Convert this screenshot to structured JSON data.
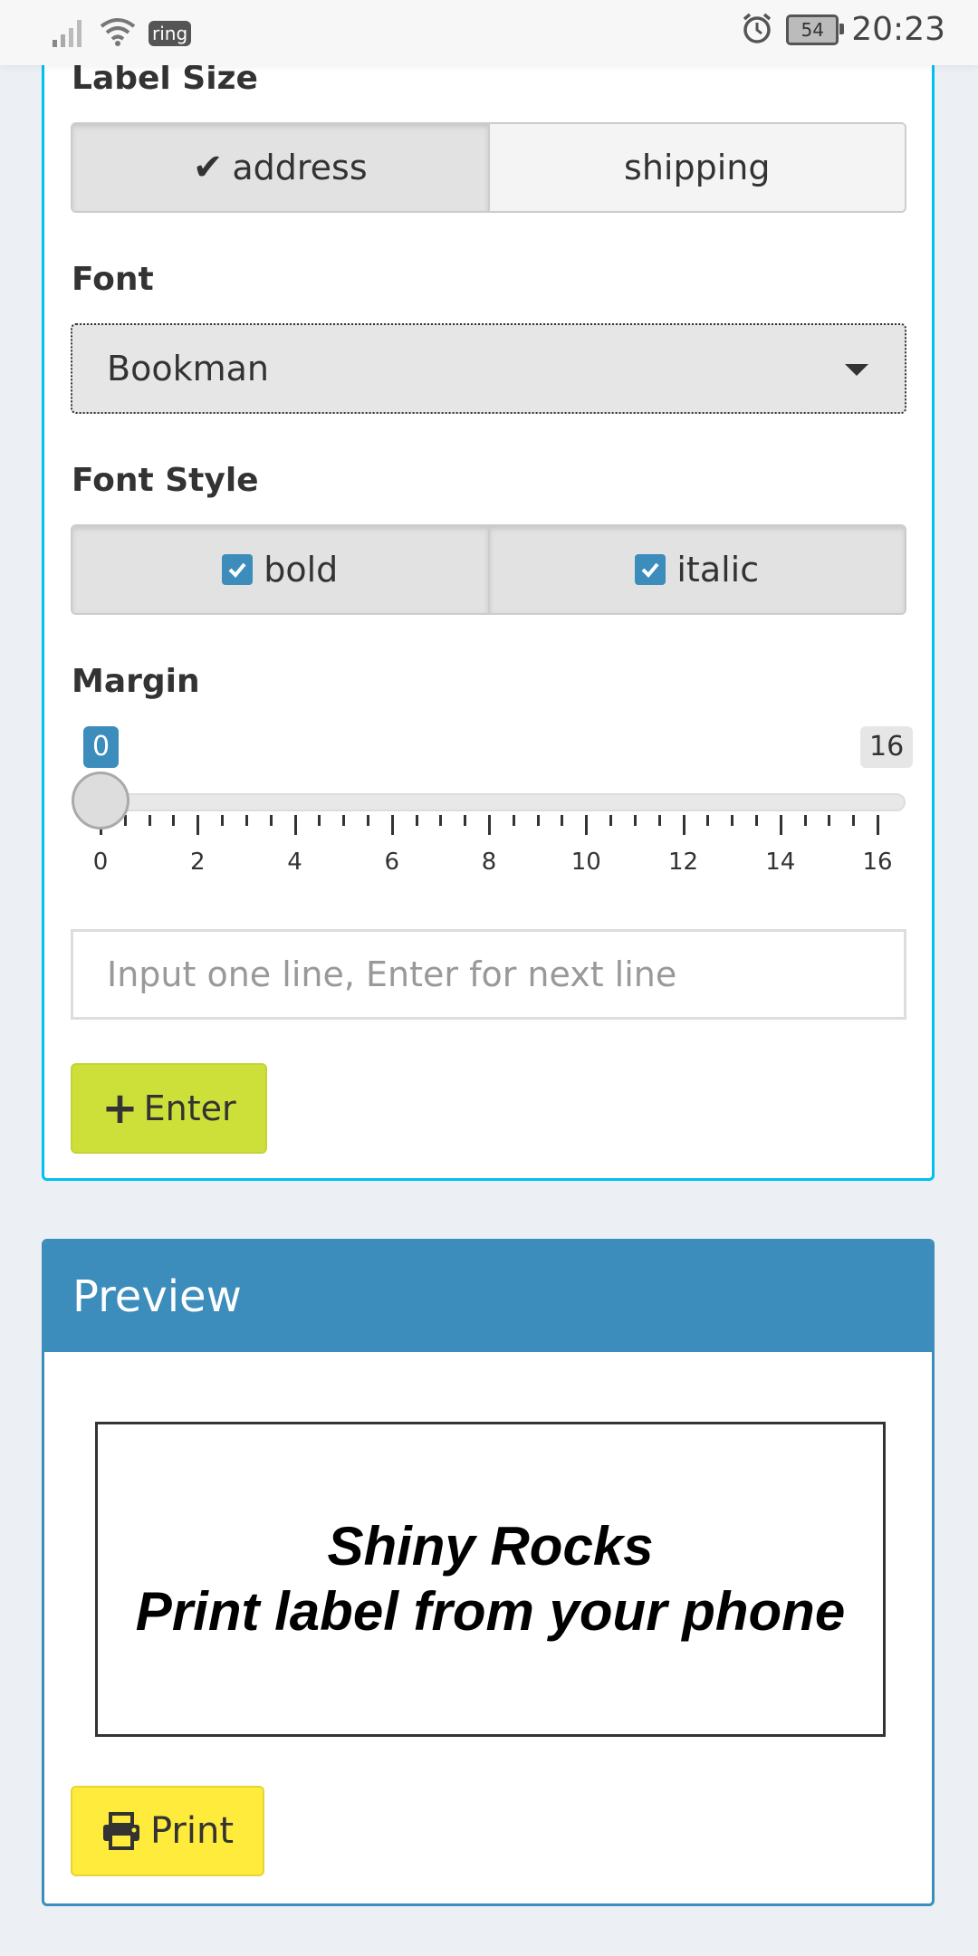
{
  "status_bar": {
    "app_badge": "ring",
    "battery": "54",
    "time": "20:23"
  },
  "settings": {
    "label_size": {
      "title": "Label Size",
      "options": [
        "address",
        "shipping"
      ],
      "selected": "address"
    },
    "font": {
      "title": "Font",
      "selected": "Bookman"
    },
    "font_style": {
      "title": "Font Style",
      "options": [
        "bold",
        "italic"
      ],
      "checked": [
        "bold",
        "italic"
      ]
    },
    "margin": {
      "title": "Margin",
      "value": 0,
      "min": 0,
      "max": 16,
      "min_label": "0",
      "max_label": "16",
      "tick_labels": [
        "0",
        "2",
        "4",
        "6",
        "8",
        "10",
        "12",
        "14",
        "16"
      ]
    },
    "line_input": {
      "placeholder": "Input one line, Enter for next line",
      "value": ""
    },
    "enter_button": "Enter"
  },
  "preview": {
    "title": "Preview",
    "lines": [
      "Shiny Rocks",
      "Print label from your phone"
    ],
    "print_button": "Print"
  },
  "colors": {
    "accent_blue": "#3c8dbc",
    "box_border_top": "#00c0ef",
    "enter_button": "#cddf39",
    "print_button": "#ffeb3b",
    "background": "#ecf0f5"
  }
}
